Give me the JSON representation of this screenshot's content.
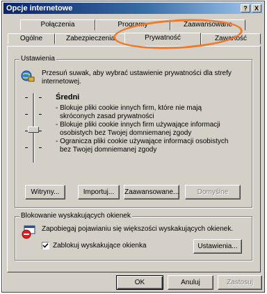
{
  "window": {
    "title": "Opcje internetowe",
    "help_button": "?",
    "close_button": "X"
  },
  "tabs_back": [
    {
      "label": "Połączenia"
    },
    {
      "label": "Programy"
    },
    {
      "label": "Zaawansowane"
    }
  ],
  "tabs_front": [
    {
      "label": "Ogólne"
    },
    {
      "label": "Zabezpieczenia"
    },
    {
      "label": "Prywatność",
      "active": true
    },
    {
      "label": "Zawartość"
    }
  ],
  "settings_group": {
    "label": "Ustawienia",
    "intro": "Przesuń suwak, aby wybrać ustawienie prywatności dla strefy internetowej.",
    "level_title": "Średni",
    "level_lines": [
      "- Blokuje pliki cookie innych firm, które nie mają",
      "skróconych zasad prywatności",
      "- Blokuje pliki cookie innych firm używające informacji",
      "osobistych bez Twojej domniemanej zgody",
      "- Ogranicza pliki cookie używające informacji osobistych",
      "bez Twojej domniemanej zgody"
    ],
    "buttons": {
      "sites": "Witryny...",
      "import": "Importuj...",
      "advanced": "Zaawansowane...",
      "default": "Domyślne"
    }
  },
  "popup_group": {
    "label": "Blokowanie wyskakujących okienek",
    "description": "Zapobiegaj pojawianiu się większości wyskakujących okienek.",
    "checkbox_label": "Zablokuj wyskakujące okienka",
    "checkbox_checked": true,
    "settings_button": "Ustawienia..."
  },
  "footer": {
    "ok": "OK",
    "cancel": "Anuluj",
    "apply": "Zastosuj"
  },
  "colors": {
    "highlight_oval": "#ef7a2a",
    "titlebar": "#0a246a"
  }
}
